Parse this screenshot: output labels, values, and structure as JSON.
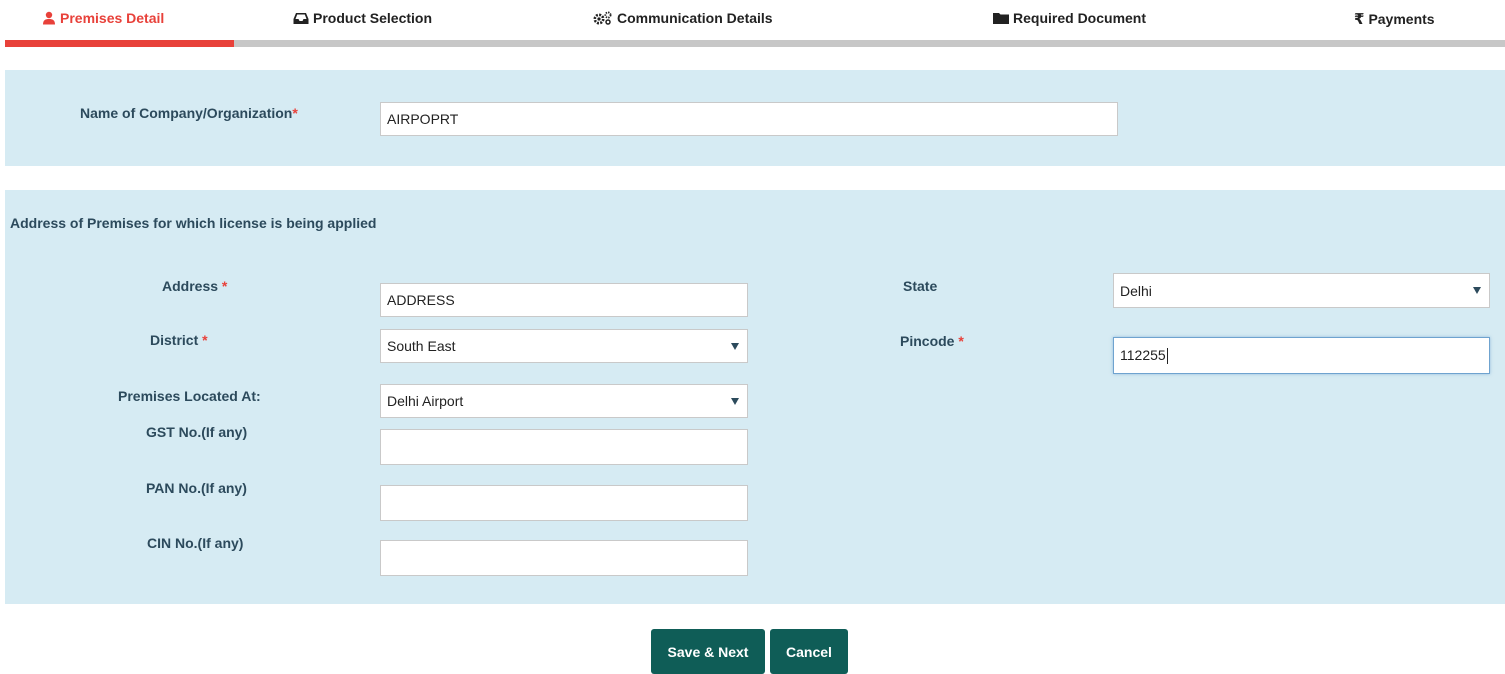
{
  "steps": [
    {
      "label": "Premises Detail",
      "icon": "user-icon",
      "active": true
    },
    {
      "label": "Product Selection",
      "icon": "inbox-icon",
      "active": false
    },
    {
      "label": "Communication Details",
      "icon": "gears-icon",
      "active": false
    },
    {
      "label": "Required Document",
      "icon": "folder-icon",
      "active": false
    },
    {
      "label": "Payments",
      "icon": "rupee-icon",
      "active": false
    }
  ],
  "progress": {
    "completed_step": 1,
    "total_steps": 5
  },
  "company": {
    "label": "Name of Company/Organization",
    "required_mark": "*",
    "value": "AIRPOPRT"
  },
  "address_section": {
    "title": "Address of Premises for which license is being applied",
    "address": {
      "label": "Address",
      "required_mark": "*",
      "value": "ADDRESS"
    },
    "district": {
      "label": "District",
      "required_mark": "*",
      "value": "South East"
    },
    "premises_located": {
      "label": "Premises Located At:",
      "value": "Delhi Airport"
    },
    "gst": {
      "label": "GST No.(If any)",
      "value": ""
    },
    "pan": {
      "label": "PAN No.(If any)",
      "value": ""
    },
    "cin": {
      "label": "CIN No.(If any)",
      "value": ""
    },
    "state": {
      "label": "State",
      "value": "Delhi"
    },
    "pincode": {
      "label": "Pincode",
      "required_mark": "*",
      "value": "112255"
    }
  },
  "buttons": {
    "save_next": "Save & Next",
    "cancel": "Cancel"
  },
  "colors": {
    "accent": "#e8413a",
    "panel": "#d6ebf3",
    "button": "#0f5d57",
    "label": "#2c4a5c"
  }
}
